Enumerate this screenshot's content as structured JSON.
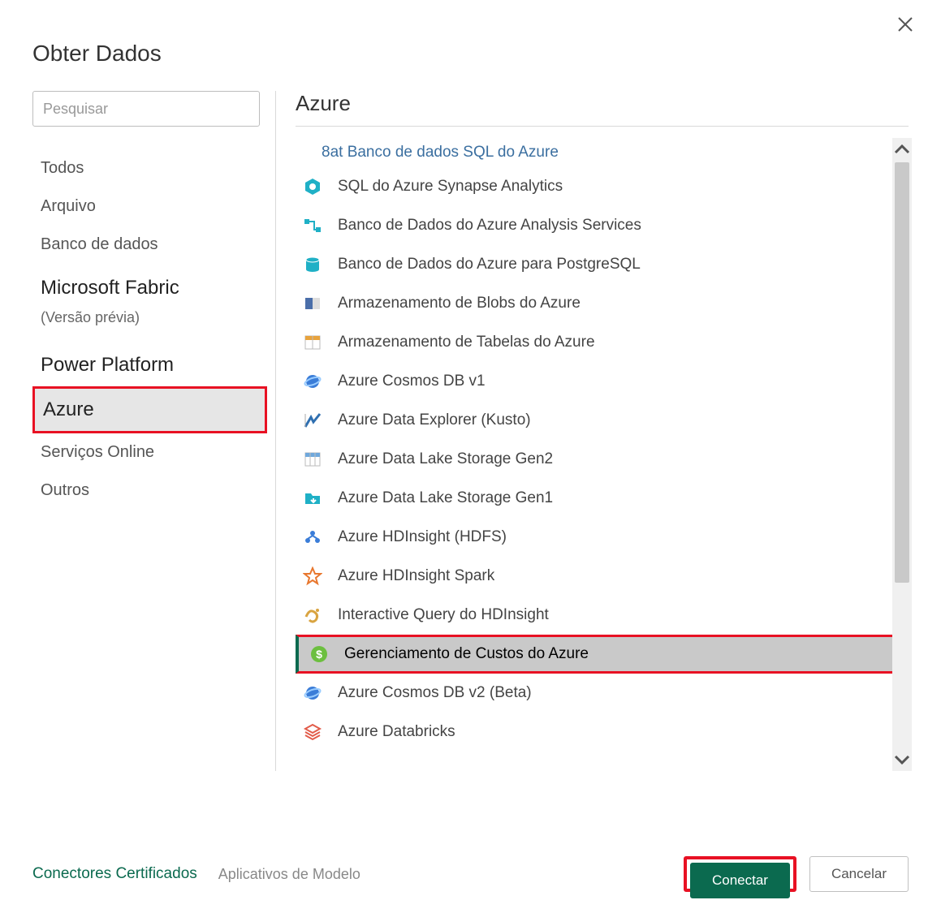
{
  "dialog": {
    "title": "Obter Dados"
  },
  "search": {
    "placeholder": "Pesquisar"
  },
  "categories": [
    {
      "label": "Todos"
    },
    {
      "label": "Arquivo"
    },
    {
      "label": "Banco de dados"
    },
    {
      "label": "Microsoft Fabric",
      "big": true
    },
    {
      "label": "(Versão prévia)",
      "sub": true
    },
    {
      "label": "Power Platform",
      "big": true
    },
    {
      "label": "Azure",
      "selected": true
    },
    {
      "label": "Serviços Online"
    },
    {
      "label": "Outros"
    }
  ],
  "panel": {
    "title": "Azure"
  },
  "top_item": "8at Banco de dados SQL do Azure",
  "items": [
    {
      "label": "SQL do Azure Synapse Analytics",
      "icon": "hex-teal"
    },
    {
      "label": "Banco de Dados do Azure Analysis Services",
      "icon": "flow-teal"
    },
    {
      "label": "Banco de Dados do Azure para PostgreSQL",
      "icon": "db-teal"
    },
    {
      "label": "Armazenamento de Blobs do Azure",
      "icon": "blob"
    },
    {
      "label": "Armazenamento de Tabelas do Azure",
      "icon": "table-yellow"
    },
    {
      "label": "Azure Cosmos DB v1",
      "icon": "cosmos"
    },
    {
      "label": "Azure Data Explorer (Kusto)",
      "icon": "kusto"
    },
    {
      "label": "Azure Data Lake Storage Gen2",
      "icon": "table-blue"
    },
    {
      "label": "Azure Data Lake Storage Gen1",
      "icon": "folder-teal"
    },
    {
      "label": "Azure HDInsight (HDFS)",
      "icon": "cluster-blue"
    },
    {
      "label": "Azure HDInsight Spark",
      "icon": "star-orange"
    },
    {
      "label": "Interactive Query do HDInsight",
      "icon": "swirl-gold"
    },
    {
      "label": "Gerenciamento de Custos do Azure",
      "icon": "dollar-green",
      "selected": true
    },
    {
      "label": "Azure Cosmos DB v2 (Beta)",
      "icon": "cosmos"
    },
    {
      "label": "Azure Databricks",
      "icon": "stack-red"
    }
  ],
  "footer": {
    "cert_link": "Conectores Certificados",
    "templates_link": "Aplicativos de Modelo",
    "connect": "Conectar",
    "cancel": "Cancelar"
  },
  "icon_colors": {
    "hex-teal": "#1fb0c6",
    "flow-teal": "#1fb0c6",
    "db-teal": "#1fb0c6",
    "blob": "#4a6ea9",
    "table-yellow": "#e8a33d",
    "cosmos": "#3b7dd8",
    "kusto": "#2f6fb0",
    "table-blue": "#6fa8dc",
    "folder-teal": "#1fb0c6",
    "cluster-blue": "#3b7dd8",
    "star-orange": "#e8772e",
    "swirl-gold": "#d9a441",
    "dollar-green": "#6cbf3f",
    "stack-red": "#e25c4a"
  }
}
